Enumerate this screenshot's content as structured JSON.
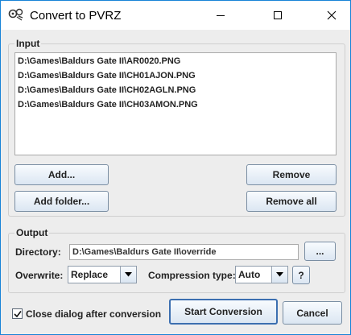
{
  "window": {
    "title": "Convert to PVRZ",
    "app_icon": "gear-icon",
    "controls": [
      "minimize-icon",
      "maximize-icon",
      "close-icon"
    ]
  },
  "input": {
    "title": "Input",
    "files": [
      "D:\\Games\\Baldurs Gate II\\AR0020.PNG",
      "D:\\Games\\Baldurs Gate II\\CH01AJON.PNG",
      "D:\\Games\\Baldurs Gate II\\CH02AGLN.PNG",
      "D:\\Games\\Baldurs Gate II\\CH03AMON.PNG"
    ],
    "add_label": "Add...",
    "add_folder_label": "Add folder...",
    "remove_label": "Remove",
    "remove_all_label": "Remove all"
  },
  "output": {
    "title": "Output",
    "directory_label": "Directory:",
    "directory_value": "D:\\Games\\Baldurs Gate II\\override",
    "browse_label": "...",
    "overwrite_label": "Overwrite:",
    "overwrite_value": "Replace",
    "compression_label": "Compression type:",
    "compression_value": "Auto",
    "help_label": "?"
  },
  "footer": {
    "close_after_label": "Close dialog after conversion",
    "close_after_checked": true,
    "start_label": "Start Conversion",
    "cancel_label": "Cancel"
  },
  "colors": {
    "window_border": "#1883d7",
    "dialog_background": "#ededed",
    "button_border": "#7a8ea3"
  }
}
